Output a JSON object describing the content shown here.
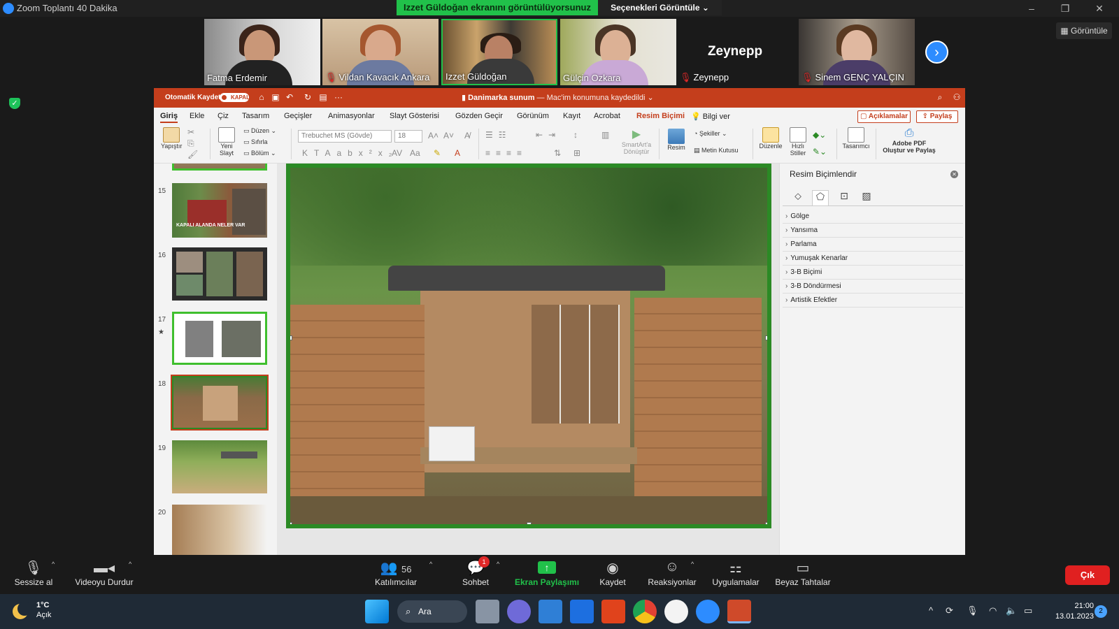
{
  "zoom_window": {
    "title": "Zoom Toplantı 40 Dakika",
    "share_banner": "Izzet Güldoğan ekranını görüntülüyorsunuz",
    "view_options": "Seçenekleri Görüntüle ⌄",
    "gallery_button": "Görüntüle"
  },
  "participants": [
    {
      "name": "Fatma Erdemir",
      "muted": false
    },
    {
      "name": "Vildan Kavacık Ankara",
      "muted": true
    },
    {
      "name": "Izzet Güldoğan",
      "muted": false
    },
    {
      "name": "Gülçin Ozkara",
      "muted": false
    },
    {
      "name": "Zeynepp",
      "muted": true,
      "video_off_label": "Zeynepp"
    },
    {
      "name": "Sinem GENÇ YALÇIN",
      "muted": true
    }
  ],
  "ppt": {
    "autosave_label": "Otomatik Kaydet",
    "autosave_state": "KAPALI",
    "doc_name": "Danimarka sunum",
    "doc_status": "— Mac'im konumuna kaydedildi ⌄",
    "menu": [
      "Giriş",
      "Ekle",
      "Çiz",
      "Tasarım",
      "Geçişler",
      "Animasyonlar",
      "Slayt Gösterisi",
      "Gözden Geçir",
      "Görünüm",
      "Kayıt",
      "Acrobat",
      "Resim Biçimi",
      "Bilgi ver"
    ],
    "comments_label": "Açıklamalar",
    "share_label": "Paylaş",
    "ribbon": {
      "paste": "Yapıştır",
      "new_slide_1": "Yeni",
      "new_slide_2": "Slayt",
      "layout": "Düzen",
      "reset": "Sıfırla",
      "section": "Bölüm",
      "font_name": "Trebuchet MS (Gövde)",
      "font_size": "18",
      "smartart_1": "SmartArt'a",
      "smartart_2": "Dönüştür",
      "picture": "Resim",
      "shapes": "Şekiller",
      "textbox": "Metin Kutusu",
      "arrange": "Düzenle",
      "quick_styles_1": "Hızlı",
      "quick_styles_2": "Stiller",
      "designer": "Tasarımcı",
      "adobe_1": "Adobe PDF",
      "adobe_2": "Oluştur ve Paylaş"
    },
    "thumbnails": [
      {
        "num": "15",
        "caption": "KAPALI ALANDA NELER VAR"
      },
      {
        "num": "16"
      },
      {
        "num": "17",
        "star": "★"
      },
      {
        "num": "18"
      },
      {
        "num": "19"
      },
      {
        "num": "20"
      }
    ],
    "format_pane": {
      "title": "Resim Biçimlendir",
      "sections": [
        "Gölge",
        "Yansıma",
        "Parlama",
        "Yumuşak Kenarlar",
        "3-B Biçimi",
        "3-B Döndürmesi",
        "Artistik Efektler"
      ]
    }
  },
  "zoom_toolbar": {
    "mute": "Sessize al",
    "stop_video": "Videoyu Durdur",
    "participants": "Katılımcılar",
    "participants_count": "56",
    "chat": "Sohbet",
    "chat_badge": "1",
    "share_screen": "Ekran Paylaşımı",
    "record": "Kaydet",
    "reactions": "Reaksiyonlar",
    "apps": "Uygulamalar",
    "whiteboard": "Beyaz Tahtalar",
    "leave": "Çık"
  },
  "taskbar": {
    "temp": "1°C",
    "condition": "Açık",
    "search": "Ara",
    "time": "21:00",
    "date": "13.01.2023",
    "notifications": "2"
  },
  "colors": {
    "ppt_accent": "#c43e1c",
    "zoom_blue": "#2d8cff",
    "share_green": "#21c14a",
    "slide_border": "#2b8a25",
    "leave_red": "#e02020"
  }
}
